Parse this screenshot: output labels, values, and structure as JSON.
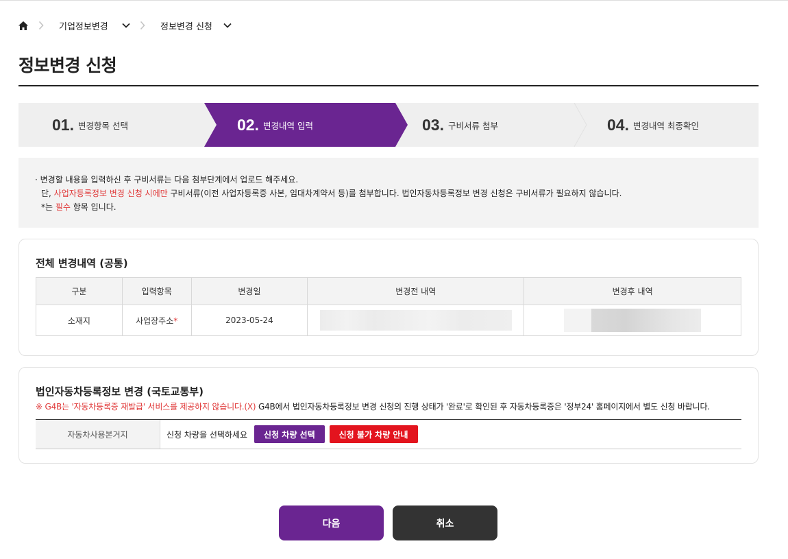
{
  "breadcrumb": {
    "items": [
      {
        "label": "기업정보변경"
      },
      {
        "label": "정보변경 신청"
      }
    ]
  },
  "page_title": "정보변경 신청",
  "steps": [
    {
      "num": "01.",
      "label": "변경항목 선택",
      "active": false
    },
    {
      "num": "02.",
      "label": "변경내역 입력",
      "active": true
    },
    {
      "num": "03.",
      "label": "구비서류 첨부",
      "active": false
    },
    {
      "num": "04.",
      "label": "변경내역 최종확인",
      "active": false
    }
  ],
  "notice": {
    "line1": "· 변경할 내용을 입력하신 후 구비서류는 다음 첨부단계에서 업로드 해주세요.",
    "line2_prefix": "단, ",
    "line2_red": "사업자등록정보 변경 신청 시에만",
    "line2_suffix": " 구비서류(이전 사업자등록증 사본, 임대차계약서 등)를 첨부합니다. 법인자동차등록정보 변경 신청은 구비서류가 필요하지 않습니다.",
    "line3_prefix": "*는 ",
    "line3_red": "필수",
    "line3_suffix": " 항목 입니다."
  },
  "common_changes": {
    "title": "전체 변경내역 (공통)",
    "headers": [
      "구분",
      "입력항목",
      "변경일",
      "변경전 내역",
      "변경후 내역"
    ],
    "row": {
      "category": "소재지",
      "field": "사업장주소",
      "required_mark": "*",
      "date": "2023-05-24"
    }
  },
  "vehicle": {
    "title": "법인자동차등록정보 변경 (국토교통부)",
    "warn_red": "※ G4B는 '자동차등록증 재발급' 서비스를 제공하지 않습니다.(X)",
    "warn_rest": " G4B에서 법인자동차등록정보 변경 신청의 진행 상태가 '완료'로 확인된 후 자동차등록증은 '정부24' 홈페이지에서 별도 신청 바랍니다.",
    "row_header": "자동차사용본거지",
    "row_text": "신청 차량을 선택하세요",
    "select_button": "신청 차량 선택",
    "ineligible_button": "신청 불가 차량 안내"
  },
  "actions": {
    "next": "다음",
    "cancel": "취소"
  },
  "colors": {
    "accent": "#6a2591",
    "danger": "#e3141e",
    "dark": "#333333"
  }
}
